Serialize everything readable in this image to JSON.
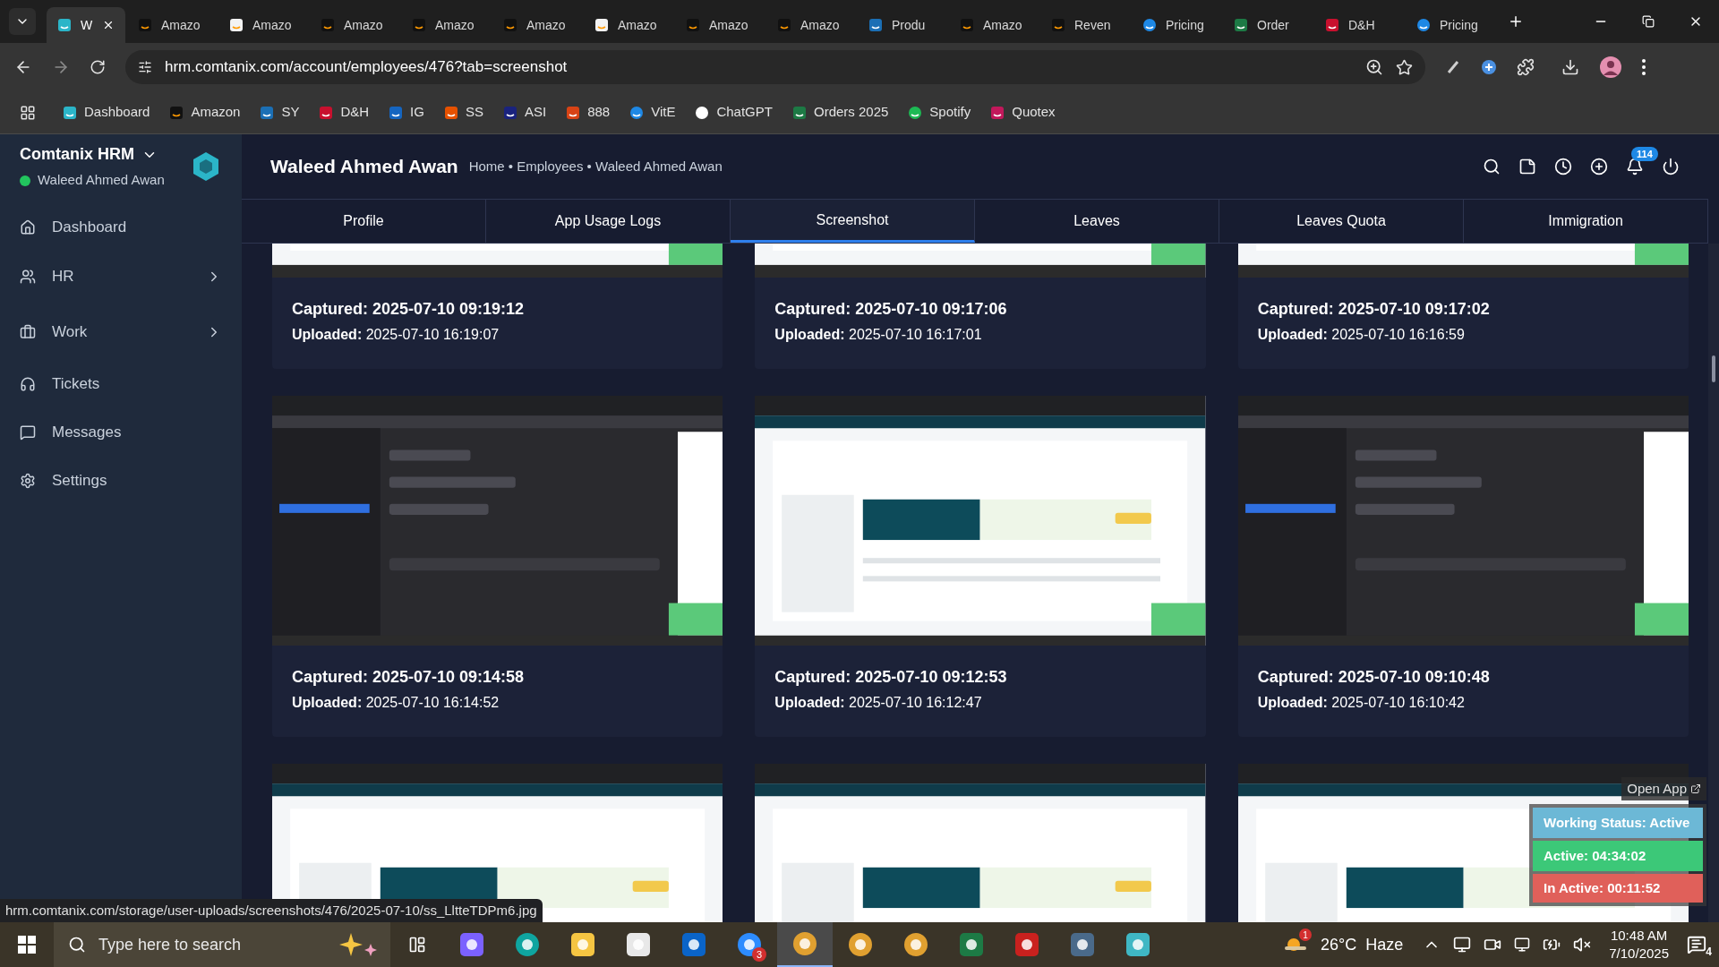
{
  "browser": {
    "tabs": [
      {
        "title": "W",
        "kind": "app",
        "selected": true
      },
      {
        "title": "Amazo",
        "kind": "amazon",
        "selected": false
      },
      {
        "title": "Amazo",
        "kind": "amazon-light",
        "selected": false
      },
      {
        "title": "Amazo",
        "kind": "amazon",
        "selected": false
      },
      {
        "title": "Amazo",
        "kind": "amazon",
        "selected": false
      },
      {
        "title": "Amazo",
        "kind": "amazon",
        "selected": false
      },
      {
        "title": "Amazo",
        "kind": "amazon-light",
        "selected": false
      },
      {
        "title": "Amazo",
        "kind": "amazon",
        "selected": false
      },
      {
        "title": "Amazo",
        "kind": "amazon",
        "selected": false
      },
      {
        "title": "Produ",
        "kind": "ec",
        "selected": false
      },
      {
        "title": "Amazo",
        "kind": "amazon",
        "selected": false
      },
      {
        "title": "Reven",
        "kind": "amazon",
        "selected": false
      },
      {
        "title": "Pricing",
        "kind": "pricing",
        "selected": false
      },
      {
        "title": "Order",
        "kind": "excel",
        "selected": false
      },
      {
        "title": "D&H",
        "kind": "dh",
        "selected": false
      },
      {
        "title": "Pricing",
        "kind": "pricing",
        "selected": false
      }
    ],
    "address": "hrm.comtanix.com/account/employees/476?tab=screenshot",
    "bookmarks": [
      {
        "label": "Dashboard",
        "kind": "app"
      },
      {
        "label": "Amazon",
        "kind": "amazon"
      },
      {
        "label": "SY",
        "kind": "ec"
      },
      {
        "label": "D&H",
        "kind": "dh"
      },
      {
        "label": "IG",
        "kind": "ig"
      },
      {
        "label": "SS",
        "kind": "ss"
      },
      {
        "label": "ASI",
        "kind": "asi"
      },
      {
        "label": "888",
        "kind": "casino"
      },
      {
        "label": "VitE",
        "kind": "pricing"
      },
      {
        "label": "ChatGPT",
        "kind": "chatgpt"
      },
      {
        "label": "Orders 2025",
        "kind": "excel"
      },
      {
        "label": "Spotify",
        "kind": "spotify"
      },
      {
        "label": "Quotex",
        "kind": "quotex"
      }
    ]
  },
  "app": {
    "brand": "Comtanix HRM",
    "user": "Waleed Ahmed Awan",
    "online": true,
    "nav": [
      {
        "label": "Dashboard",
        "kind": "home",
        "expandable": false
      },
      {
        "label": "HR",
        "kind": "users",
        "expandable": true
      },
      {
        "label": "Work",
        "kind": "briefcase",
        "expandable": true
      },
      {
        "label": "Tickets",
        "kind": "headset",
        "expandable": false
      },
      {
        "label": "Messages",
        "kind": "message",
        "expandable": false
      },
      {
        "label": "Settings",
        "kind": "settings",
        "expandable": false
      }
    ],
    "header": {
      "title": "Waleed Ahmed Awan",
      "breadcrumb": "Home • Employees • Waleed Ahmed Awan",
      "notifications": "114"
    },
    "tabs": [
      {
        "label": "Profile",
        "selected": false
      },
      {
        "label": "App Usage Logs",
        "selected": false
      },
      {
        "label": "Screenshot",
        "selected": true
      },
      {
        "label": "Leaves",
        "selected": false
      },
      {
        "label": "Leaves Quota",
        "selected": false
      },
      {
        "label": "Immigration",
        "selected": false
      }
    ],
    "cards": [
      {
        "kind": "picture",
        "captured": "Captured: 2025-07-10 09:19:12",
        "uploaded": "**Uploaded:** 2025-07-10 16:19:07"
      },
      {
        "kind": "picture",
        "captured": "Captured: 2025-07-10 09:17:06",
        "uploaded": "**Uploaded:** 2025-07-10 16:17:01"
      },
      {
        "kind": "picture",
        "captured": "Captured: 2025-07-10 09:17:02",
        "uploaded": "**Uploaded:** 2025-07-10 16:16:59"
      },
      {
        "kind": "picture",
        "captured": "Captured: 2025-07-10 09:14:58",
        "uploaded": "**Uploaded:** 2025-07-10 16:14:52"
      },
      {
        "kind": "picture",
        "captured": "Captured: 2025-07-10 09:12:53",
        "uploaded": "**Uploaded:** 2025-07-10 16:12:47"
      },
      {
        "kind": "picture",
        "captured": "Captured: 2025-07-10 09:10:48",
        "uploaded": "**Uploaded:** 2025-07-10 16:10:42"
      },
      {
        "kind": "picture"
      },
      {
        "kind": "picture"
      },
      {
        "kind": "picture"
      }
    ]
  },
  "status_url": "hrm.comtanix.com/storage/user-uploads/screenshots/476/2025-07-10/ss_LltteTDPm6.jpg",
  "widget": {
    "open_app": "Open App",
    "working_status": "Working Status: Active",
    "active": "Active: 04:34:02",
    "inactive": "In Active: 00:11:52"
  },
  "taskbar": {
    "search_placeholder": "Type here to search",
    "apps": [
      {
        "kind": "copilot",
        "active": false
      },
      {
        "kind": "edge",
        "active": false
      },
      {
        "kind": "folder",
        "active": false
      },
      {
        "kind": "store",
        "active": false
      },
      {
        "kind": "outlook",
        "active": false
      },
      {
        "kind": "zoom",
        "badge": "3",
        "active": false
      },
      {
        "kind": "chrome",
        "active": true
      },
      {
        "kind": "chrome",
        "active": false
      },
      {
        "kind": "chrome",
        "active": false
      },
      {
        "kind": "excel",
        "active": false
      },
      {
        "kind": "filezilla",
        "active": false
      },
      {
        "kind": "calculator",
        "active": false
      },
      {
        "kind": "app",
        "active": false
      }
    ],
    "weather_badge": "1",
    "weather": "26°C  Haze",
    "time": "10:48 AM",
    "date": "7/10/2025",
    "notifications": "4"
  }
}
